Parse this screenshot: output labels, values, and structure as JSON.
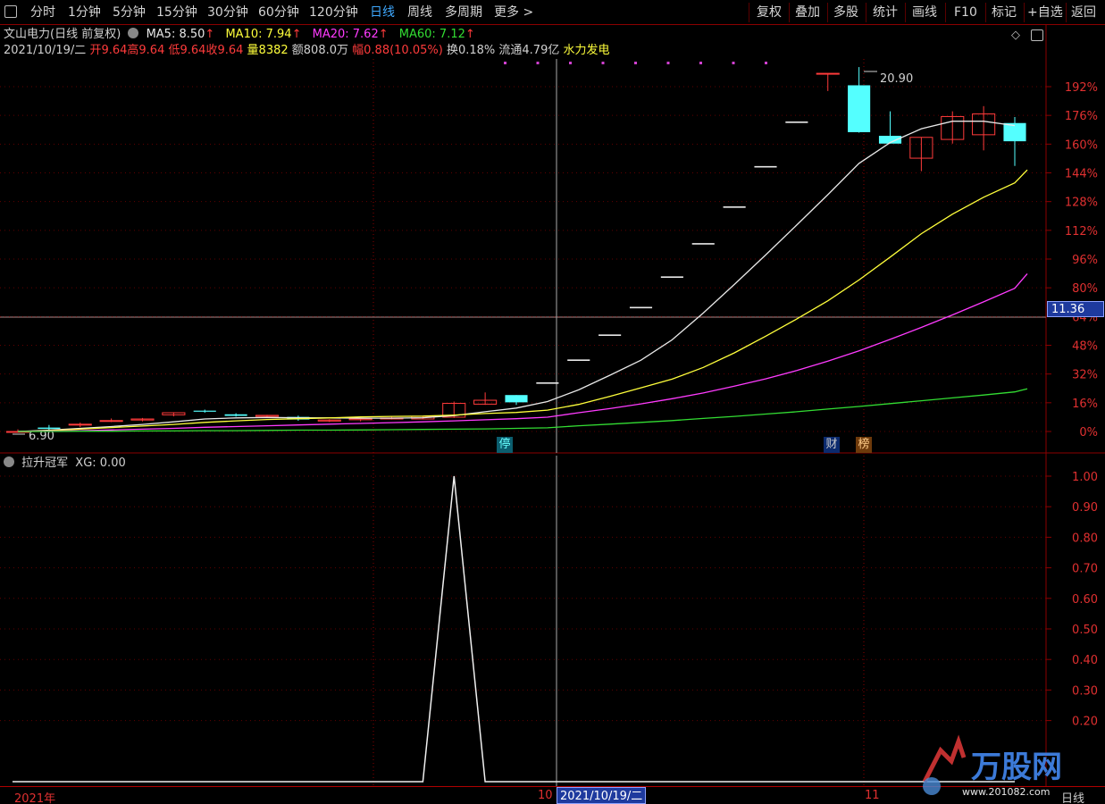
{
  "toolbar": {
    "periods": [
      "分时",
      "1分钟",
      "5分钟",
      "15分钟",
      "30分钟",
      "60分钟",
      "120分钟",
      "日线",
      "周线",
      "多周期",
      "更多 >"
    ],
    "active_period": "日线",
    "actions": [
      "复权",
      "叠加",
      "多股",
      "统计",
      "画线",
      "F10",
      "标记",
      "+自选",
      "返回"
    ]
  },
  "header": {
    "title": "文山电力(日线 前复权)",
    "ma5": "MA5: 8.50",
    "ma10": "MA10: 7.94",
    "ma20": "MA20: 7.62",
    "ma60": "MA60: 7.12",
    "date": "2021/10/19/二",
    "open": "开9.64",
    "high": "高9.64",
    "low": "低9.64",
    "close": "收9.64",
    "volume": "量8382",
    "amount": "额808.0万",
    "change": "幅0.88(10.05%)",
    "turnover": "换0.18%",
    "float": "流通4.79亿",
    "sector": "水力发电"
  },
  "colors": {
    "up": "#ff3b3b",
    "down": "#54ffff",
    "ma5": "#e8e8e8",
    "ma10": "#ffff3b",
    "ma20": "#ff3bff",
    "ma60": "#33dd33",
    "axis": "#e03030",
    "grid": "#8b0000",
    "crosshair_badge": "#1e3a9e"
  },
  "crosshair": {
    "price_label": "11.36"
  },
  "tags": {
    "limit": "停",
    "finance": "财",
    "rank": "榜"
  },
  "chart_data": {
    "type": "line",
    "title": "文山电力(日线 前复权)",
    "xlabel": "",
    "ylabel": "",
    "y_axis_ticks": [
      "192%",
      "176%",
      "160%",
      "144%",
      "128%",
      "112%",
      "96%",
      "80%",
      "64%",
      "48%",
      "32%",
      "16%",
      "0%"
    ],
    "ylim_pct": [
      0,
      200
    ],
    "base_price": 6.9,
    "high_label": "20.90",
    "low_label": "6.90",
    "candles": [
      {
        "o": 6.9,
        "h": 6.98,
        "l": 6.9,
        "c": 6.9
      },
      {
        "o": 7.05,
        "h": 7.15,
        "l": 6.96,
        "c": 7.0
      },
      {
        "o": 7.15,
        "h": 7.24,
        "l": 7.07,
        "c": 7.18
      },
      {
        "o": 7.3,
        "h": 7.4,
        "l": 7.26,
        "c": 7.32
      },
      {
        "o": 7.34,
        "h": 7.42,
        "l": 7.29,
        "c": 7.38
      },
      {
        "o": 7.54,
        "h": 7.64,
        "l": 7.48,
        "c": 7.62
      },
      {
        "o": 7.7,
        "h": 7.74,
        "l": 7.62,
        "c": 7.66
      },
      {
        "o": 7.56,
        "h": 7.6,
        "l": 7.47,
        "c": 7.5
      },
      {
        "o": 7.48,
        "h": 7.54,
        "l": 7.44,
        "c": 7.52
      },
      {
        "o": 7.46,
        "h": 7.51,
        "l": 7.31,
        "c": 7.36
      },
      {
        "o": 7.3,
        "h": 7.37,
        "l": 7.26,
        "c": 7.34
      },
      {
        "o": 7.35,
        "h": 7.43,
        "l": 7.29,
        "c": 7.39
      },
      {
        "o": 7.38,
        "h": 7.46,
        "l": 7.36,
        "c": 7.42
      },
      {
        "o": 7.38,
        "h": 7.5,
        "l": 7.36,
        "c": 7.48
      },
      {
        "o": 7.45,
        "h": 8.05,
        "l": 7.42,
        "c": 7.98
      },
      {
        "o": 7.95,
        "h": 8.4,
        "l": 7.92,
        "c": 8.1
      },
      {
        "o": 8.3,
        "h": 8.3,
        "l": 7.92,
        "c": 8.02
      },
      {
        "o": 8.76,
        "h": 8.76,
        "l": 8.76,
        "c": 8.76
      },
      {
        "o": 9.64,
        "h": 9.64,
        "l": 9.64,
        "c": 9.64
      },
      {
        "o": 10.6,
        "h": 10.6,
        "l": 10.6,
        "c": 10.6
      },
      {
        "o": 11.66,
        "h": 11.66,
        "l": 11.66,
        "c": 11.66
      },
      {
        "o": 12.83,
        "h": 12.83,
        "l": 12.83,
        "c": 12.83
      },
      {
        "o": 14.11,
        "h": 14.11,
        "l": 14.11,
        "c": 14.11
      },
      {
        "o": 15.52,
        "h": 15.52,
        "l": 15.52,
        "c": 15.52
      },
      {
        "o": 17.07,
        "h": 17.07,
        "l": 17.07,
        "c": 17.07
      },
      {
        "o": 18.78,
        "h": 18.78,
        "l": 18.78,
        "c": 18.78
      },
      {
        "o": 20.66,
        "h": 20.66,
        "l": 19.98,
        "c": 20.66
      },
      {
        "o": 20.2,
        "h": 20.9,
        "l": 18.38,
        "c": 18.4
      },
      {
        "o": 18.26,
        "h": 19.2,
        "l": 17.96,
        "c": 17.96
      },
      {
        "o": 17.4,
        "h": 18.2,
        "l": 16.9,
        "c": 18.2
      },
      {
        "o": 18.12,
        "h": 19.2,
        "l": 17.96,
        "c": 19.0
      },
      {
        "o": 18.3,
        "h": 19.4,
        "l": 17.7,
        "c": 19.1
      },
      {
        "o": 18.75,
        "h": 18.98,
        "l": 17.1,
        "c": 18.05
      }
    ],
    "series": [
      {
        "name": "MA5",
        "values": [
          6.9,
          6.95,
          7.02,
          7.09,
          7.17,
          7.27,
          7.38,
          7.42,
          7.44,
          7.43,
          7.42,
          7.41,
          7.41,
          7.43,
          7.51,
          7.66,
          7.8,
          8.05,
          8.5,
          9.06,
          9.64,
          10.42,
          11.45,
          12.55,
          13.68,
          14.83,
          16.0,
          17.2,
          18.0,
          18.53,
          18.82,
          18.82,
          18.65
        ]
      },
      {
        "name": "MA10",
        "values": [
          6.9,
          6.93,
          6.99,
          7.05,
          7.11,
          7.17,
          7.25,
          7.31,
          7.36,
          7.39,
          7.42,
          7.46,
          7.48,
          7.49,
          7.53,
          7.59,
          7.63,
          7.72,
          7.94,
          8.25,
          8.58,
          8.91,
          9.36,
          9.92,
          10.56,
          11.22,
          11.92,
          12.72,
          13.6,
          14.5,
          15.25,
          15.9,
          16.45,
          16.95
        ]
      },
      {
        "name": "MA20",
        "values": [
          6.9,
          6.91,
          6.93,
          6.96,
          6.99,
          7.02,
          7.06,
          7.09,
          7.12,
          7.15,
          7.18,
          7.21,
          7.24,
          7.27,
          7.31,
          7.35,
          7.39,
          7.45,
          7.62,
          7.78,
          7.96,
          8.16,
          8.38,
          8.64,
          8.92,
          9.24,
          9.6,
          10.0,
          10.44,
          10.9,
          11.38,
          11.88,
          12.4,
          12.96
        ]
      },
      {
        "name": "MA60",
        "values": [
          6.9,
          6.9,
          6.91,
          6.91,
          6.92,
          6.92,
          6.93,
          6.93,
          6.94,
          6.95,
          6.95,
          6.96,
          6.97,
          6.98,
          6.99,
          7.0,
          7.02,
          7.04,
          7.12,
          7.18,
          7.25,
          7.32,
          7.4,
          7.48,
          7.57,
          7.66,
          7.76,
          7.86,
          7.97,
          8.08,
          8.19,
          8.3,
          8.42,
          8.54
        ]
      }
    ],
    "dates_axis": [
      "2021年",
      "10",
      "2021/10/19/二",
      "11",
      "日线"
    ]
  },
  "indicator": {
    "name": "拉升冠军",
    "value_label": "XG: 0.00",
    "y_axis_ticks": [
      "1.00",
      "0.90",
      "0.80",
      "0.70",
      "0.60",
      "0.50",
      "0.40",
      "0.30",
      "0.20"
    ],
    "values": [
      0,
      0,
      0,
      0,
      0,
      0,
      0,
      0,
      0,
      0,
      0,
      0,
      0,
      0,
      1,
      0,
      0,
      0,
      0,
      0,
      0,
      0,
      0,
      0,
      0,
      0,
      0,
      0,
      0,
      0,
      0,
      0,
      0
    ]
  },
  "watermark": {
    "text": "万股网",
    "url_text": "www.201082.com"
  }
}
